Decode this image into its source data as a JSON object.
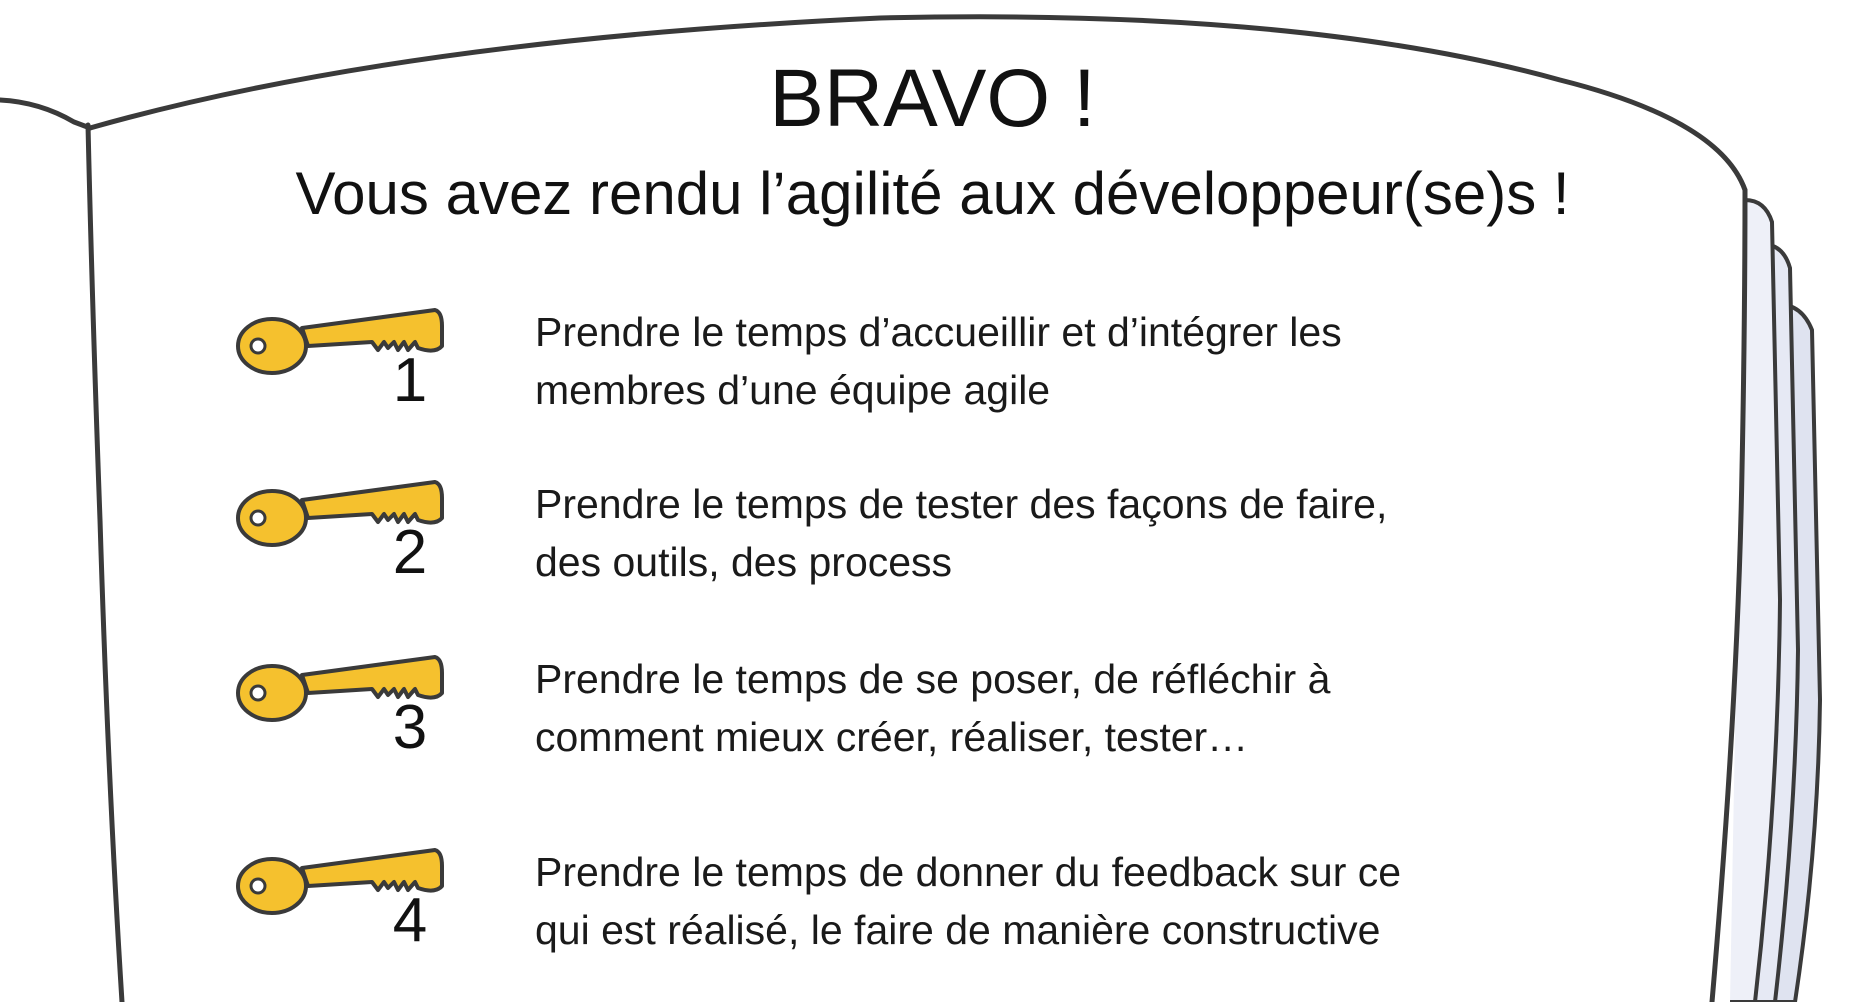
{
  "title": "BRAVO !",
  "subtitle": "Vous avez rendu l’agilité aux développeur(se)s !",
  "colors": {
    "key_fill": "#F5C12E",
    "outline": "#3a3a3a",
    "page_edge_fill": "#dfe3f0"
  },
  "icon": "key-icon",
  "keys": [
    {
      "number": "1",
      "line1": "Prendre le temps d’accueillir et d’intégrer les",
      "line2": "membres d’une équipe agile"
    },
    {
      "number": "2",
      "line1": "Prendre le temps de tester des façons de faire,",
      "line2": "des outils, des process"
    },
    {
      "number": "3",
      "line1": "Prendre le temps de se poser, de réfléchir à",
      "line2": "comment mieux créer, réaliser, tester…"
    },
    {
      "number": "4",
      "line1": "Prendre le temps de donner du feedback sur ce",
      "line2": "qui est réalisé, le faire de manière constructive"
    }
  ]
}
